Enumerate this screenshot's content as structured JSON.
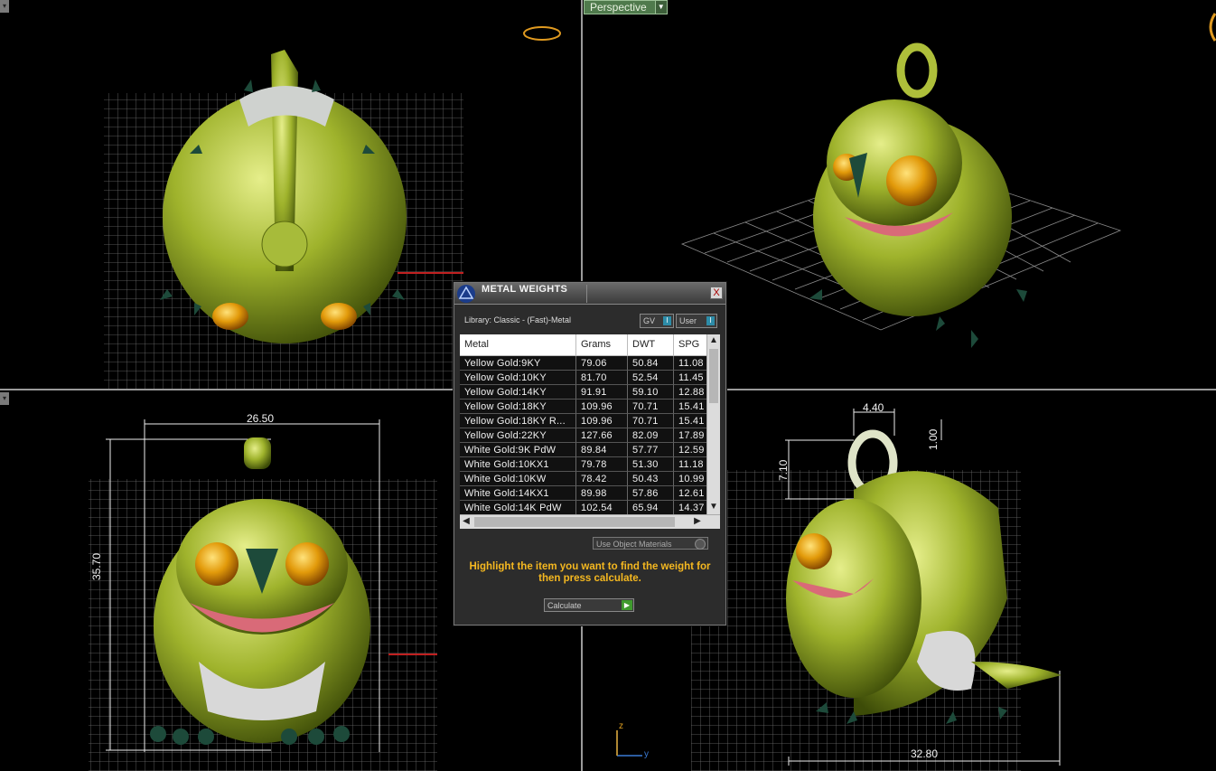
{
  "viewport": {
    "perspective_label": "Perspective",
    "dimensions": {
      "front_width": "26.50",
      "front_height": "35.70",
      "right_bail_width": "4.40",
      "right_bail_gap": "1.00",
      "right_bail_height": "7.10",
      "right_length": "32.80"
    },
    "axis": {
      "z": "z",
      "y": "y"
    }
  },
  "dialog": {
    "title": "METAL WEIGHTS",
    "close_label": "X",
    "library_label": "Library: Classic - (Fast)-Metal",
    "toggle_gv": "GV",
    "toggle_user": "User",
    "columns": [
      "Metal",
      "Grams",
      "DWT",
      "SPG"
    ],
    "rows": [
      [
        "Yellow Gold:9KY",
        "79.06",
        "50.84",
        "11.08"
      ],
      [
        "Yellow Gold:10KY",
        "81.70",
        "52.54",
        "11.45"
      ],
      [
        "Yellow Gold:14KY",
        "91.91",
        "59.10",
        "12.88"
      ],
      [
        "Yellow Gold:18KY",
        "109.96",
        "70.71",
        "15.41"
      ],
      [
        "Yellow Gold:18KY R...",
        "109.96",
        "70.71",
        "15.41"
      ],
      [
        "Yellow Gold:22KY",
        "127.66",
        "82.09",
        "17.89"
      ],
      [
        "White Gold:9K PdW",
        "89.84",
        "57.77",
        "12.59"
      ],
      [
        "White Gold:10KX1",
        "79.78",
        "51.30",
        "11.18"
      ],
      [
        "White Gold:10KW",
        "78.42",
        "50.43",
        "10.99"
      ],
      [
        "White Gold:14KX1",
        "89.98",
        "57.86",
        "12.61"
      ],
      [
        "White Gold:14K PdW",
        "102.54",
        "65.94",
        "14.37"
      ]
    ],
    "use_object_materials": "Use Object Materials",
    "hint": "Highlight the item you want to find the weight for then press calculate.",
    "calculate_label": "Calculate"
  },
  "colors": {
    "model_green": "#9fb32c",
    "grid": "#7a7a7a",
    "hint_text": "#f5b820",
    "accent_green": "#4f7a4c"
  }
}
